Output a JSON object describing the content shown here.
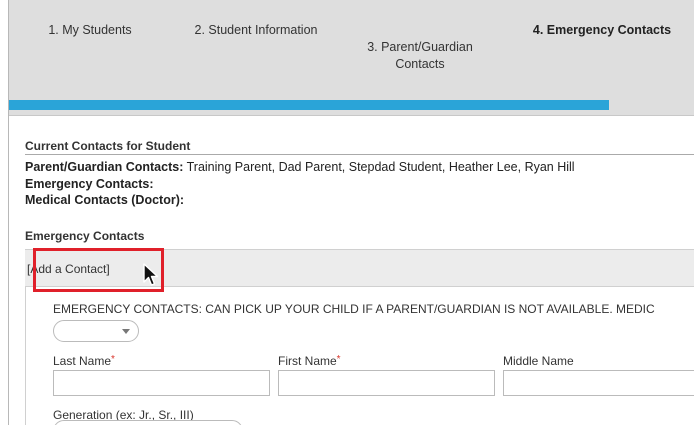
{
  "steps": [
    {
      "label": "1. My Students"
    },
    {
      "label": "2. Student Information"
    },
    {
      "label": "3. Parent/Guardian\nContacts"
    },
    {
      "label": "4. Emergency Contacts"
    }
  ],
  "progress_fraction": 0.875,
  "current_contacts": {
    "title": "Current Contacts for Student",
    "parent_label": "Parent/Guardian Contacts:",
    "parent_value": " Training Parent, Dad Parent, Stepdad Student, Heather Lee, Ryan Hill",
    "emergency_label": "Emergency Contacts:",
    "medical_label": "Medical Contacts (Doctor):"
  },
  "emergency": {
    "title": "Emergency Contacts",
    "add_contact": "[Add a Contact]",
    "notice": "EMERGENCY CONTACTS: CAN PICK UP YOUR CHILD IF A PARENT/GUARDIAN IS NOT AVAILABLE. MEDIC",
    "fields": {
      "last_name": "Last Name",
      "first_name": "First Name",
      "middle_name": "Middle Name",
      "generation": "Generation (ex: Jr., Sr., III)"
    },
    "required_mark": "*"
  },
  "colors": {
    "progress": "#2aa4d8",
    "highlight": "#e0202a",
    "required": "#d9342b"
  },
  "icons": [
    "mouse-pointer-icon",
    "chevron-down-icon"
  ]
}
